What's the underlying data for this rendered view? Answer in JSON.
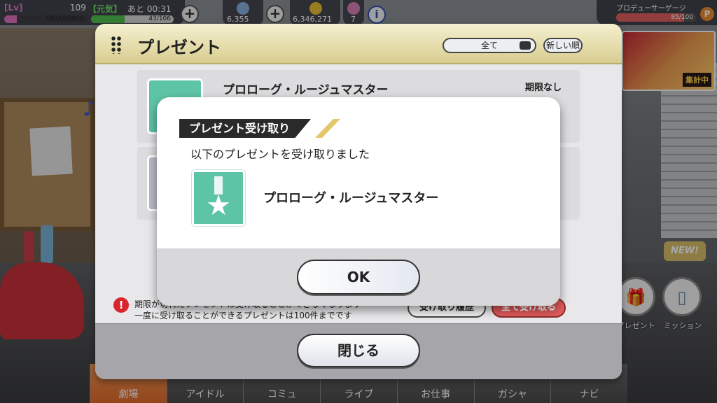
{
  "hud": {
    "lv_label": "[Lv]",
    "lv_value": "109",
    "genki_label": "【元気】",
    "remain_time": "あと 00:31",
    "exp_text": "1632/10850",
    "exp_progress": 0.15,
    "stamina_text": "43/106",
    "stamina_progress": 0.41,
    "jewels": "6,355",
    "money": "6,346,271",
    "tickets": "7",
    "info_glyph": "i",
    "producer_gauge_label": "プロデューサーゲージ",
    "producer_gauge_text": "85/100",
    "producer_gauge_progress": 0.85,
    "producer_gauge_icon": "P"
  },
  "banner": {
    "tag": "集計中"
  },
  "side": {
    "new_badge": "NEW!",
    "present_label": "プレゼント",
    "mission_label": "ミッション"
  },
  "nav": {
    "items": [
      "劇場",
      "アイドル",
      "コミュ",
      "ライブ",
      "お仕事",
      "ガシャ",
      "ナビ"
    ]
  },
  "panel": {
    "title": "プレゼント",
    "filter_label": "全て",
    "sort_label": "新しい順",
    "rows": [
      {
        "name": "プロローグ・ルージュマスター",
        "limit": "期限なし"
      },
      {
        "name": "",
        "limit": ""
      }
    ],
    "note_line1": "期限が切れたプレゼントは受け取ることができなくなります",
    "note_line2": "一度に受け取ることができるプレゼントは100件までです",
    "history_button": "受け取り履歴",
    "receive_all_button": "全て受け取る",
    "close_button": "閉じる"
  },
  "modal": {
    "tag": "プレゼント受け取り",
    "message": "以下のプレゼントを受け取りました",
    "item_name": "プロローグ・ルージュマスター",
    "ok_button": "OK"
  },
  "colors": {
    "accent_orange": "#e46a2a",
    "medal_green": "#5ec4a6",
    "header_gold": "#d8cd90",
    "warning_red": "#d9262d"
  }
}
